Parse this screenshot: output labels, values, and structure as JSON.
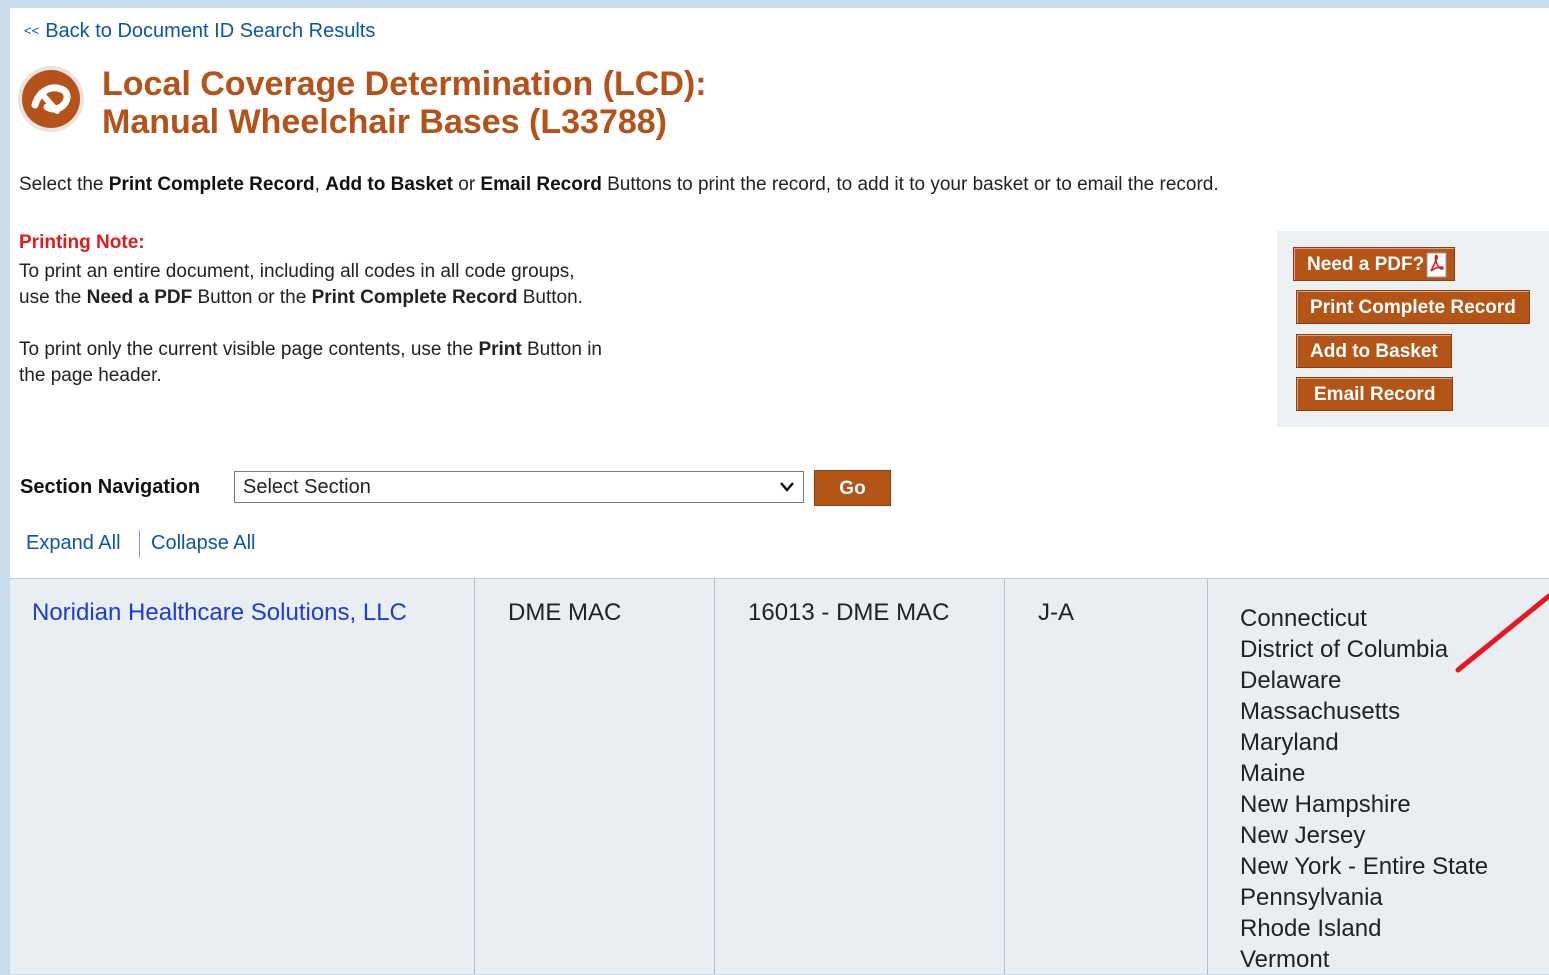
{
  "back_link": {
    "arrows": "<<",
    "label": "Back to Document ID Search Results"
  },
  "title": "Local Coverage Determination (LCD):\nManual Wheelchair Bases (L33788)",
  "instructions": {
    "t1": "Select the ",
    "b1": "Print Complete Record",
    "t2": ", ",
    "b2": "Add to Basket",
    "t3": " or ",
    "b3": "Email Record",
    "t4": " Buttons to print the record, to add it to your basket or to email the record."
  },
  "printing_note": {
    "title": "Printing Note:",
    "p1_l1": "To print an entire document, including all codes in all code groups,",
    "p1_l2a": "use the ",
    "p1_l2b": "Need a PDF",
    "p1_l2c": " Button or the ",
    "p1_l2d": "Print Complete Record",
    "p1_l2e": " Button.",
    "p2_l1a": "To print only the current visible page contents, use the ",
    "p2_l1b": "Print",
    "p2_l1c": " Button in",
    "p2_l2": "the page header."
  },
  "buttons": {
    "need_pdf": "Need a PDF?",
    "print_complete": "Print Complete Record",
    "add_basket": "Add to Basket",
    "email_record": "Email Record"
  },
  "section_nav": {
    "label": "Section Navigation",
    "selected": "Select Section",
    "go": "Go"
  },
  "expand_all": "Expand All",
  "collapse_all": "Collapse All",
  "row": {
    "contractor": "Noridian Healthcare Solutions, LLC",
    "type": "DME MAC",
    "number": "16013 - DME MAC",
    "jurisdiction": "J-A",
    "states": [
      "Connecticut",
      "District of Columbia",
      "Delaware",
      "Massachusetts",
      "Maryland",
      "Maine",
      "New Hampshire",
      "New Jersey",
      "New York - Entire State",
      "Pennsylvania",
      "Rhode Island",
      "Vermont"
    ]
  },
  "colors": {
    "accent": "#b45416",
    "title": "#b5521a",
    "link": "#0b57a6",
    "note": "#e01b1b",
    "annotation_arrow": "#e8161f"
  }
}
